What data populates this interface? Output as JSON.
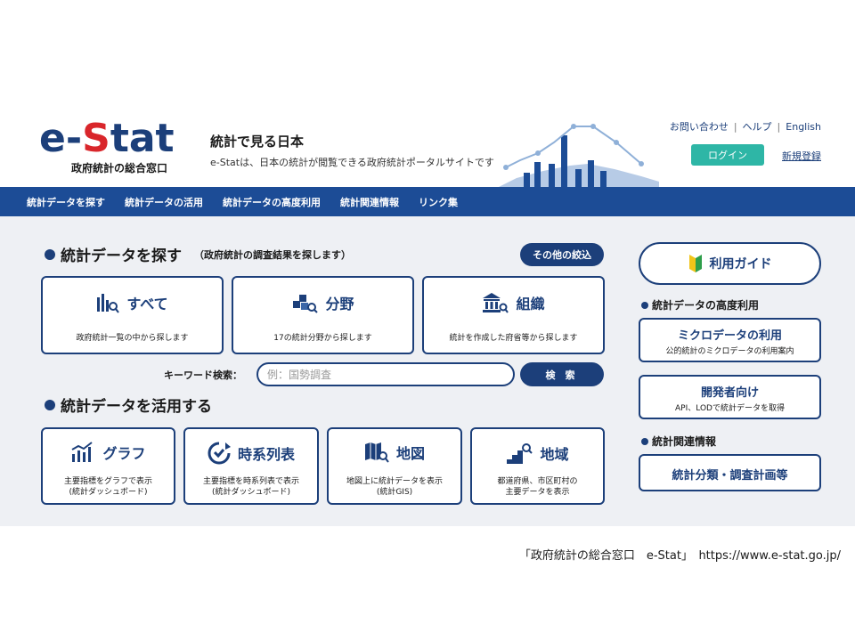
{
  "header": {
    "logo_text_pre": "e-",
    "logo_text_s": "S",
    "logo_text_post": "tat",
    "logo_subtitle": "政府統計の総合窓口",
    "tagline": "統計で見る日本",
    "tagline_sub": "e-Statは、日本の統計が閲覧できる政府統計ポータルサイトです",
    "links": [
      "お問い合わせ",
      "ヘルプ",
      "English"
    ],
    "login": "ログイン",
    "register": "新規登録"
  },
  "nav": {
    "items": [
      "統計データを探す",
      "統計データの活用",
      "統計データの高度利用",
      "統計関連情報",
      "リンク集"
    ]
  },
  "search_section": {
    "title": "統計データを探す",
    "note": "（政府統計の調査結果を探します）",
    "filter_button": "その他の絞込",
    "cards": [
      {
        "title": "すべて",
        "desc": "政府統計一覧の中から探します",
        "icon": "bar-chart-search-icon"
      },
      {
        "title": "分野",
        "desc": "17の統計分野から探します",
        "icon": "cubes-search-icon"
      },
      {
        "title": "組織",
        "desc": "統計を作成した府省等から探します",
        "icon": "building-search-icon"
      }
    ],
    "keyword_label": "キーワード検索：",
    "keyword_placeholder": "例：国勢調査",
    "search_button": "検 索"
  },
  "use_section": {
    "title": "統計データを活用する",
    "cards": [
      {
        "title": "グラフ",
        "desc1": "主要指標をグラフで表示",
        "desc2": "(統計ダッシュボード)",
        "icon": "graph-icon"
      },
      {
        "title": "時系列表",
        "desc1": "主要指標を時系列表で表示",
        "desc2": "(統計ダッシュボード)",
        "icon": "clock-icon"
      },
      {
        "title": "地図",
        "desc1": "地図上に統計データを表示",
        "desc2": "(統計GIS)",
        "icon": "map-search-icon"
      },
      {
        "title": "地域",
        "desc1": "都道府県、市区町村の",
        "desc2": "主要データを表示",
        "icon": "stairs-search-icon"
      }
    ]
  },
  "side": {
    "guide": "利用ガイド",
    "advanced_title": "統計データの高度利用",
    "micro_title": "ミクロデータの利用",
    "micro_desc": "公的統計のミクロデータの利用案内",
    "dev_title": "開発者向け",
    "dev_desc": "API、LODで統計データを取得",
    "related_title": "統計関連情報",
    "classification": "統計分類・調査計画等"
  },
  "source": "「政府統計の総合窓口　e-Stat」　https://www.e-stat.go.jp/",
  "colors": {
    "brand_navy": "#1c3f7a",
    "nav_blue": "#1c4c96",
    "logo_red": "#d9262b",
    "login_teal": "#2eb6a6"
  }
}
